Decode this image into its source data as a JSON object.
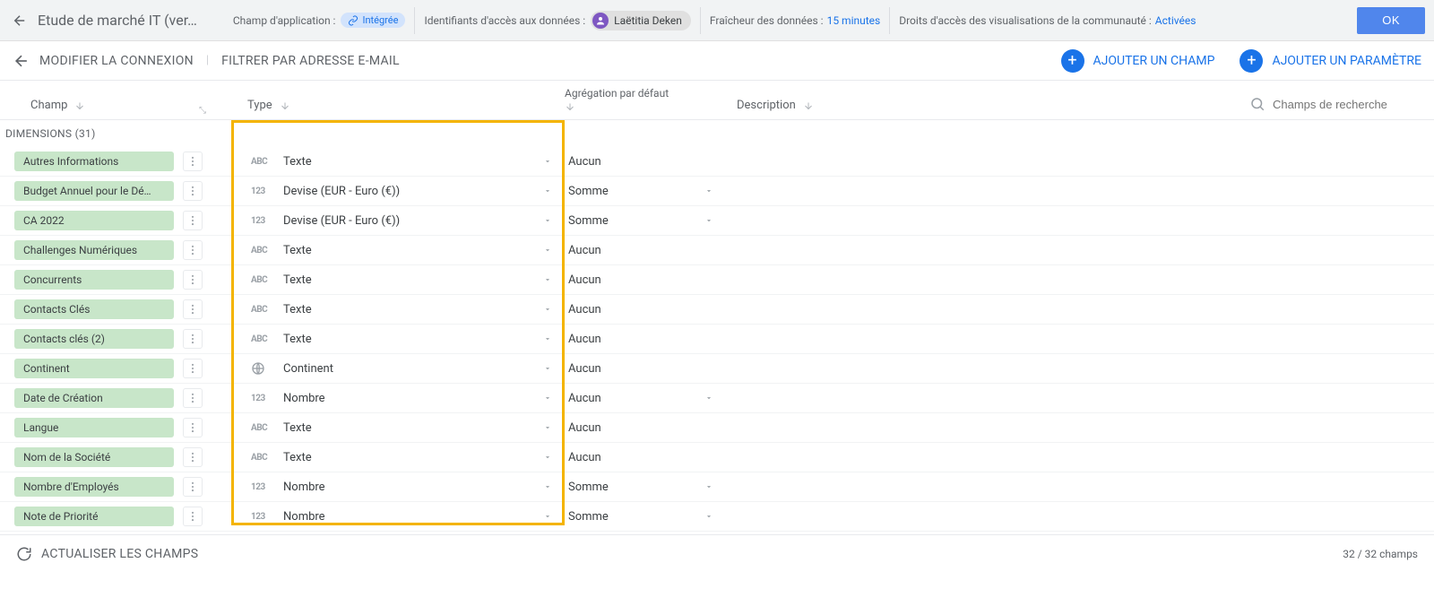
{
  "topbar": {
    "title": "Etude de marché IT (ver…",
    "scope_label": "Champ d'application :",
    "scope_value": "Intégrée",
    "creds_label": "Identifiants d'accès aux données :",
    "creds_user": "Laëtitia Deken",
    "freshness_label": "Fraîcheur des données :",
    "freshness_value": "15 minutes",
    "community_label": "Droits d'accès des visualisations de la communauté :",
    "community_value": "Activées",
    "ok": "OK"
  },
  "actionbar": {
    "modify": "MODIFIER LA CONNEXION",
    "filter": "FILTRER PAR ADRESSE E-MAIL",
    "add_field": "AJOUTER UN CHAMP",
    "add_param": "AJOUTER UN PARAMÈTRE"
  },
  "headers": {
    "champ": "Champ",
    "type": "Type",
    "aggregation": "Agrégation par défaut",
    "description": "Description",
    "search_placeholder": "Champs de recherche"
  },
  "section": {
    "label": "DIMENSIONS (31)"
  },
  "rows": [
    {
      "name": "Autres Informations",
      "icon": "ABC",
      "type": "Texte",
      "agg": "Aucun",
      "agg_drop": false
    },
    {
      "name": "Budget Annuel pour le Dé…",
      "icon": "123",
      "type": "Devise (EUR - Euro (€))",
      "agg": "Somme",
      "agg_drop": true
    },
    {
      "name": "CA 2022",
      "icon": "123",
      "type": "Devise (EUR - Euro (€))",
      "agg": "Somme",
      "agg_drop": true
    },
    {
      "name": "Challenges Numériques",
      "icon": "ABC",
      "type": "Texte",
      "agg": "Aucun",
      "agg_drop": false
    },
    {
      "name": "Concurrents",
      "icon": "ABC",
      "type": "Texte",
      "agg": "Aucun",
      "agg_drop": false
    },
    {
      "name": "Contacts Clés",
      "icon": "ABC",
      "type": "Texte",
      "agg": "Aucun",
      "agg_drop": false
    },
    {
      "name": "Contacts clés (2)",
      "icon": "ABC",
      "type": "Texte",
      "agg": "Aucun",
      "agg_drop": false
    },
    {
      "name": "Continent",
      "icon": "GLOBE",
      "type": "Continent",
      "agg": "Aucun",
      "agg_drop": false
    },
    {
      "name": "Date de Création",
      "icon": "123",
      "type": "Nombre",
      "agg": "Aucun",
      "agg_drop": true
    },
    {
      "name": "Langue",
      "icon": "ABC",
      "type": "Texte",
      "agg": "Aucun",
      "agg_drop": false
    },
    {
      "name": "Nom de la Société",
      "icon": "ABC",
      "type": "Texte",
      "agg": "Aucun",
      "agg_drop": false
    },
    {
      "name": "Nombre d'Employés",
      "icon": "123",
      "type": "Nombre",
      "agg": "Somme",
      "agg_drop": true
    },
    {
      "name": "Note de Priorité",
      "icon": "123",
      "type": "Nombre",
      "agg": "Somme",
      "agg_drop": true
    }
  ],
  "footer": {
    "refresh": "ACTUALISER LES CHAMPS",
    "counter": "32 / 32 champs"
  }
}
